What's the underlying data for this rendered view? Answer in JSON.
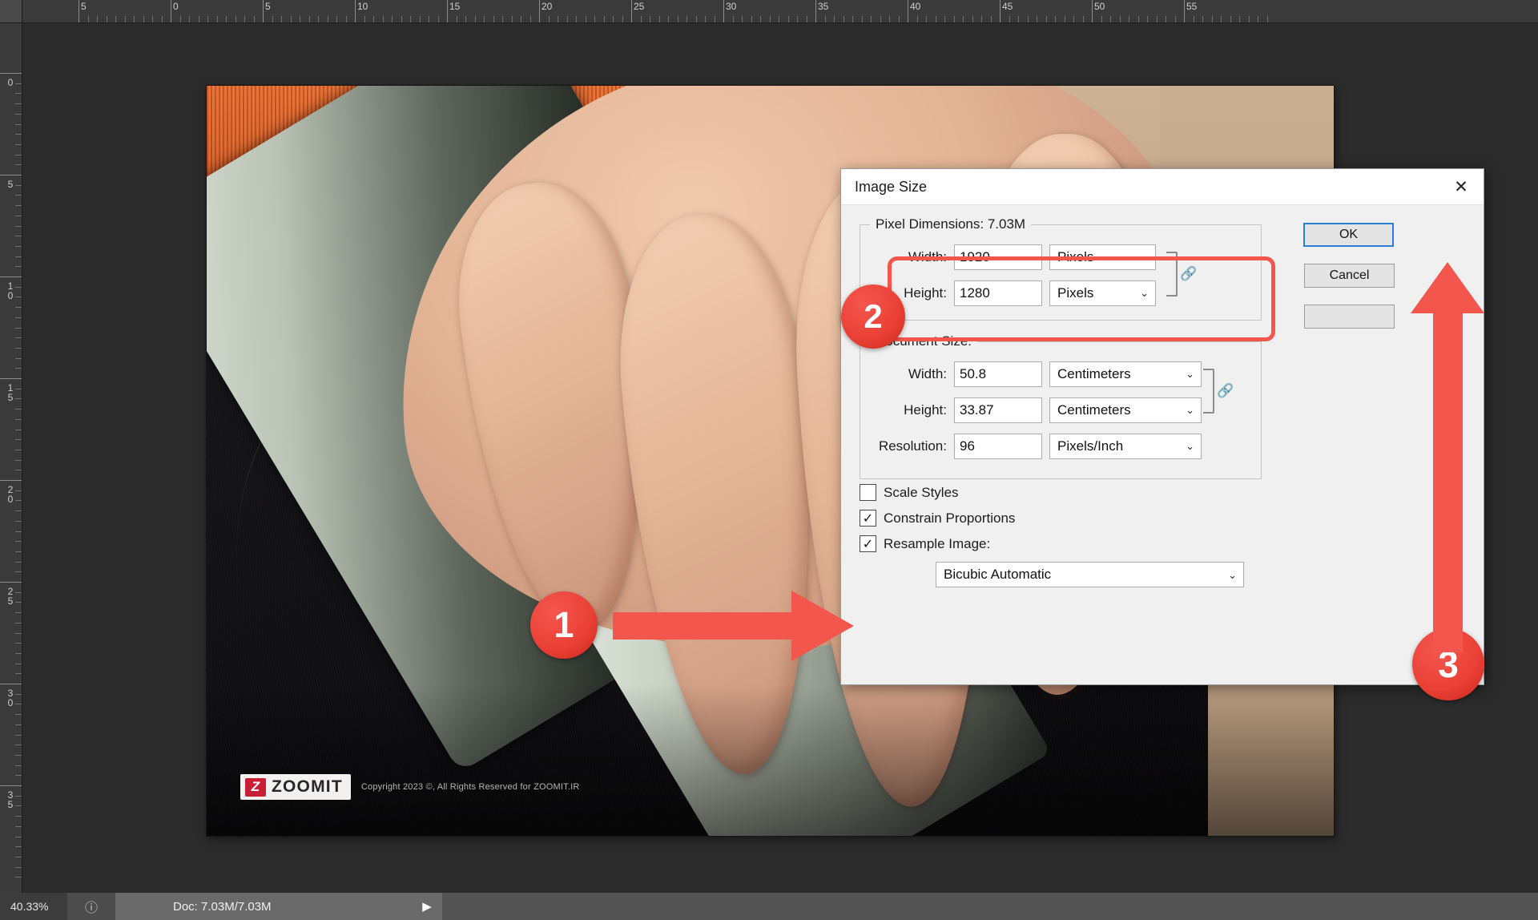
{
  "app": {
    "canvas_bg": "#2b2b2b",
    "accent_red": "#f2564c"
  },
  "rulers": {
    "horizontal_unit": "cm",
    "horizontal_labels": [
      "5",
      "0",
      "5",
      "10",
      "15",
      "20",
      "25",
      "30",
      "35",
      "40",
      "45",
      "50",
      "55"
    ],
    "vertical_labels": [
      "0",
      "5",
      "10",
      "15",
      "20",
      "25",
      "30",
      "35"
    ]
  },
  "watermark": {
    "mark": "Z",
    "name": "ZOOMIT",
    "copyright": "Copyright 2023 ©, All Rights Reserved for ZOOMIT.IR"
  },
  "annotations": {
    "badge1": "1",
    "badge2": "2",
    "badge3": "3"
  },
  "dialog": {
    "title": "Image Size",
    "close_glyph": "✕",
    "pixel_group": {
      "legend": "Pixel Dimensions:  7.03M",
      "size_text": "7.03M",
      "rows": [
        {
          "label": "Width:",
          "value": "1920",
          "unit": "Pixels"
        },
        {
          "label": "Height:",
          "value": "1280",
          "unit": "Pixels"
        }
      ],
      "chain_icon": "link-icon"
    },
    "document_group": {
      "legend": "Document Size:",
      "rows": [
        {
          "label": "Width:",
          "value": "50.8",
          "unit": "Centimeters"
        },
        {
          "label": "Height:",
          "value": "33.87",
          "unit": "Centimeters"
        },
        {
          "label": "Resolution:",
          "value": "96",
          "unit": "Pixels/Inch"
        }
      ],
      "chain_icon": "link-icon"
    },
    "checkboxes": [
      {
        "label": "Scale Styles",
        "checked": false,
        "mark": ""
      },
      {
        "label": "Constrain Proportions",
        "checked": true,
        "mark": "✓"
      },
      {
        "label": "Resample Image:",
        "checked": true,
        "mark": "✓"
      }
    ],
    "resample_method": "Bicubic Automatic",
    "chevron": "⌄",
    "buttons": [
      {
        "label": "OK",
        "primary": true
      },
      {
        "label": "Cancel",
        "primary": false
      },
      {
        "label": "",
        "primary": false
      }
    ]
  },
  "statusbar": {
    "zoom": "40.33%",
    "icon": "clock-icon",
    "doc": "Doc: 7.03M/7.03M",
    "expand_glyph": "▶"
  }
}
